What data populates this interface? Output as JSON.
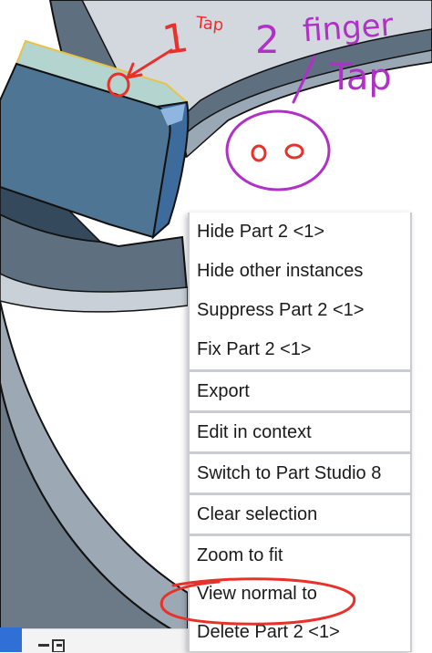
{
  "context_menu": {
    "groups": [
      {
        "items": [
          {
            "label": "Hide Part 2 <1>"
          },
          {
            "label": "Hide other instances"
          },
          {
            "label": "Suppress Part 2 <1>"
          },
          {
            "label": "Fix Part 2 <1>"
          }
        ]
      },
      {
        "items": [
          {
            "label": "Export"
          }
        ]
      },
      {
        "items": [
          {
            "label": "Edit in context"
          }
        ]
      },
      {
        "items": [
          {
            "label": "Switch to Part Studio 8"
          }
        ]
      },
      {
        "items": [
          {
            "label": "Clear selection"
          }
        ]
      },
      {
        "items": [
          {
            "label": "Zoom to fit"
          },
          {
            "label": "View normal to"
          },
          {
            "label": "Delete Part 2 <1>"
          }
        ]
      }
    ]
  },
  "annotations": {
    "tap_1": {
      "text1": "1",
      "text2": "Tap",
      "color": "#e8312a"
    },
    "tap_2": {
      "text1": "2",
      "text2": "finger",
      "text3": "Tap",
      "color": "#b030c8"
    }
  },
  "colors": {
    "part_face": "#4f7594",
    "part_top": "#b3d4cf",
    "part_edge_highlight": "#e8c34a",
    "ring_surface": "#5e6f80",
    "accent_blue": "#2f6fd6"
  }
}
